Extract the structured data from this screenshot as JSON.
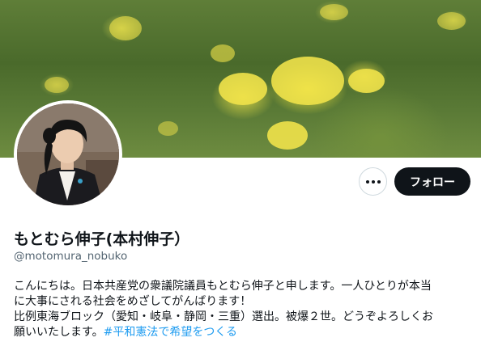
{
  "profile": {
    "display_name": "もとむら伸子(本村伸子）",
    "handle": "@motomura_nobuko",
    "bio_lines": [
      "こんにちは。日本共産党の衆議院議員もとむら伸子と申します。一人ひとりが本当",
      "に大事にされる社会をめざしてがんばります！",
      "比例東海ブロック（愛知・岐阜・静岡・三重）選出。被爆２世。どうぞよろしくお",
      "願いいたします。"
    ],
    "bio_hashtag": "#平和憲法で希望をつくる"
  },
  "actions": {
    "follow_label": "フォロー",
    "more_icon": "more-horizontal-icon"
  },
  "colors": {
    "follow_bg": "#0f1419",
    "hashtag": "#1d9bf0",
    "secondary_text": "#536471"
  }
}
